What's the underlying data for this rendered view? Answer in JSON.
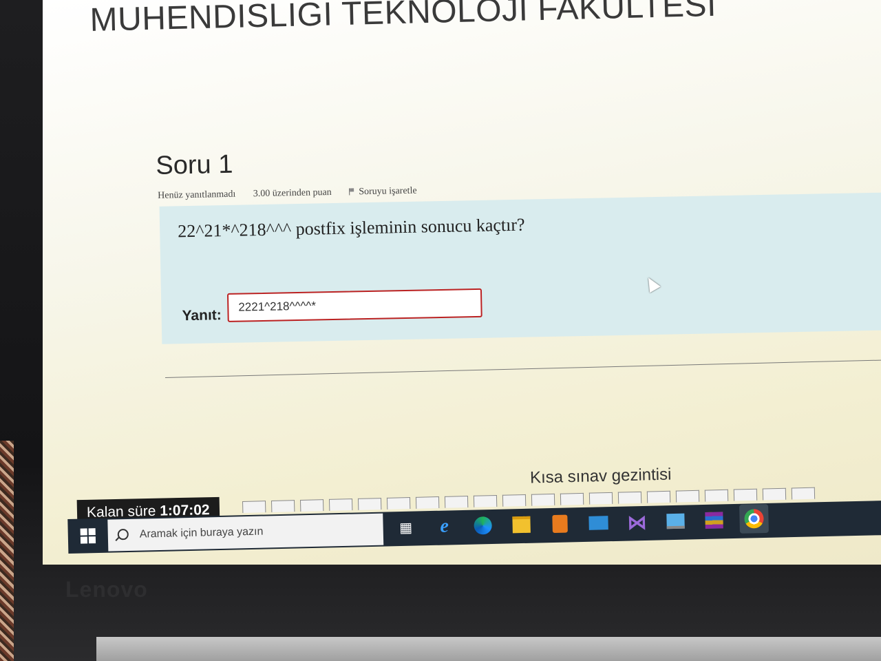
{
  "page": {
    "title": "MUHENDISLIGI TEKNOLOJI FAKULTESI"
  },
  "question": {
    "number_label": "Soru 1",
    "status": "Henüz yanıtlanmadı",
    "points": "3.00 üzerinden puan",
    "flag_label": "Soruyu işaretle",
    "text": "22^21*^218^^^ postfix işleminin sonucu kaçtır?",
    "answer_label": "Yanıt:",
    "answer_value": "2221^218^^^^*"
  },
  "quiz_nav": {
    "title": "Kısa sınav gezintisi",
    "cell_count": 20
  },
  "timer": {
    "label": "Kalan süre",
    "value": "1:07:02"
  },
  "taskbar": {
    "search_placeholder": "Aramak için buraya yazın",
    "icons": [
      "task-view-icon",
      "internet-explorer-icon",
      "edge-icon",
      "file-explorer-icon",
      "media-player-icon",
      "mail-icon",
      "visual-studio-icon",
      "this-pc-icon",
      "winrar-icon",
      "chrome-icon"
    ]
  },
  "device": {
    "brand": "Lenovo"
  }
}
